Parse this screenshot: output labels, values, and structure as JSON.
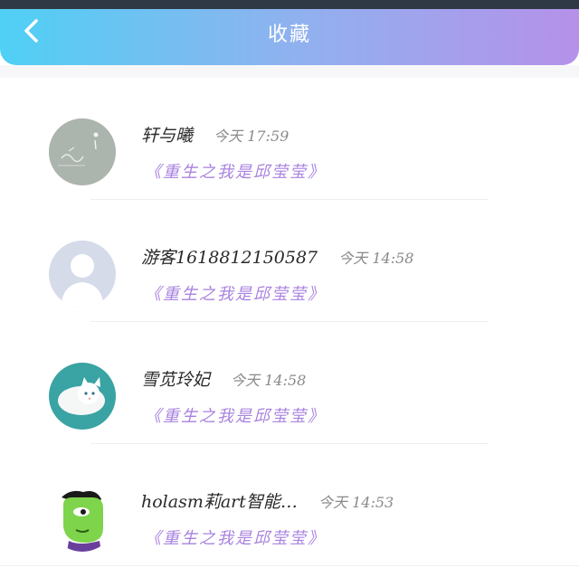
{
  "header": {
    "title": "收藏",
    "back_icon": "chevron-left-icon",
    "gradient": [
      "#4fd0f4",
      "#8fb2ef",
      "#b591ea"
    ]
  },
  "items": [
    {
      "name": "轩与曦",
      "time": "今天 17:59",
      "work": "《重生之我是邱莹莹》",
      "avatar": "chalkboard-photo"
    },
    {
      "name": "游客1618812150587",
      "time": "今天 14:58",
      "work": "《重生之我是邱莹莹》",
      "avatar": "default-person"
    },
    {
      "name": "雪苋玲妃",
      "time": "今天 14:58",
      "work": "《重生之我是邱莹莹》",
      "avatar": "white-cat"
    },
    {
      "name": "holasm莉art智能…",
      "time": "今天 14:53",
      "work": "《重生之我是邱莹莹》",
      "avatar": "green-hulk"
    }
  ],
  "colors": {
    "work_title": "#a882df",
    "name": "#2a2a2a",
    "time": "#8a8a8a"
  }
}
